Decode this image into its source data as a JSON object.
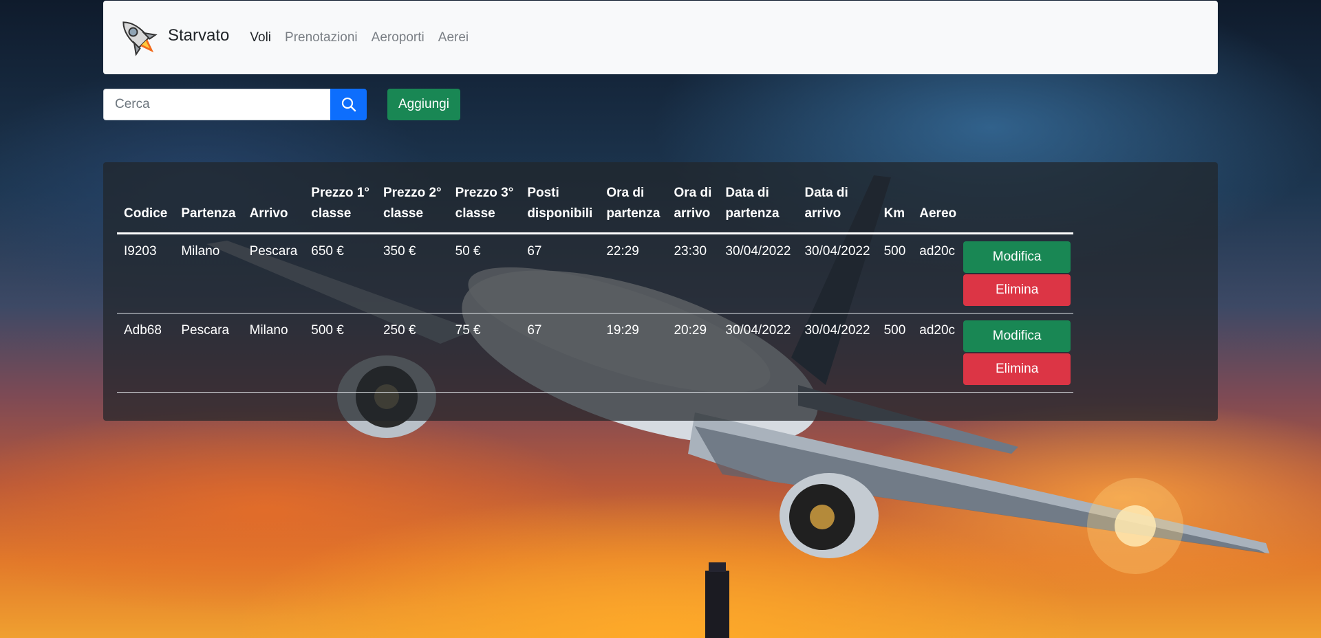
{
  "brand": {
    "name": "Starvato"
  },
  "nav": {
    "items": [
      {
        "label": "Voli",
        "active": true
      },
      {
        "label": "Prenotazioni",
        "active": false
      },
      {
        "label": "Aeroporti",
        "active": false
      },
      {
        "label": "Aerei",
        "active": false
      }
    ]
  },
  "search": {
    "placeholder": "Cerca",
    "value": ""
  },
  "toolbar": {
    "add_label": "Aggiungi"
  },
  "table": {
    "headers": [
      {
        "line1": "Codice",
        "line2": ""
      },
      {
        "line1": "Partenza",
        "line2": ""
      },
      {
        "line1": "Arrivo",
        "line2": ""
      },
      {
        "line1": "Prezzo 1°",
        "line2": "classe"
      },
      {
        "line1": "Prezzo 2°",
        "line2": "classe"
      },
      {
        "line1": "Prezzo 3°",
        "line2": "classe"
      },
      {
        "line1": "Posti",
        "line2": "disponibili"
      },
      {
        "line1": "Ora di",
        "line2": "partenza"
      },
      {
        "line1": "Ora di",
        "line2": "arrivo"
      },
      {
        "line1": "Data di",
        "line2": "partenza"
      },
      {
        "line1": "Data di",
        "line2": "arrivo"
      },
      {
        "line1": "Km",
        "line2": ""
      },
      {
        "line1": "Aereo",
        "line2": ""
      }
    ],
    "rows": [
      {
        "cells": [
          "I9203",
          "Milano",
          "Pescara",
          "650 €",
          "350 €",
          "50 €",
          "67",
          "22:29",
          "23:30",
          "30/04/2022",
          "30/04/2022",
          "500",
          "ad20c"
        ],
        "edit_label": "Modifica",
        "delete_label": "Elimina"
      },
      {
        "cells": [
          "Adb68",
          "Pescara",
          "Milano",
          "500 €",
          "250 €",
          "75 €",
          "67",
          "19:29",
          "20:29",
          "30/04/2022",
          "30/04/2022",
          "500",
          "ad20c"
        ],
        "edit_label": "Modifica",
        "delete_label": "Elimina"
      }
    ]
  }
}
